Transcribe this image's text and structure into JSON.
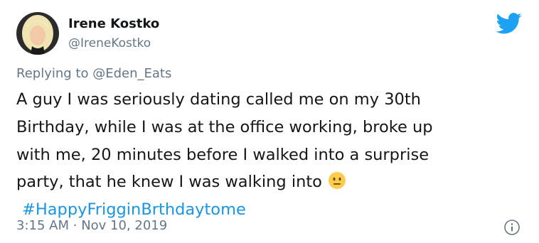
{
  "author": {
    "display_name": "Irene Kostko",
    "handle": "@IreneKostko",
    "avatar": "profile-photo"
  },
  "reply": {
    "prefix": "Replying to",
    "mention": "@Eden_Eats"
  },
  "tweet": {
    "text": "A guy I was seriously dating called me on my 30th\nBirthday, while I was at the office working, broke up\nwith me, 20 minutes before I walked into a surprise\nparty, that he knew I was walking into",
    "emoji": "neutral-face-emoji",
    "hashtag": "#HappyFrigginBrthdaytome"
  },
  "meta": {
    "time": "3:15 AM",
    "separator": "·",
    "date": "Nov 10, 2019"
  },
  "icons": {
    "brand": "twitter-bird-icon",
    "info": "info-icon"
  },
  "colors": {
    "link": "#1b95e0",
    "secondary_text": "#657786",
    "twitter_blue": "#1da1f2",
    "text": "#14171a"
  }
}
